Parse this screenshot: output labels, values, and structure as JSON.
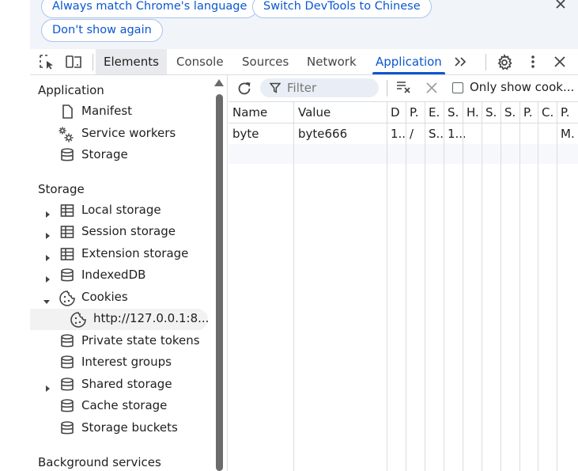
{
  "language_bar": {
    "always_match_label": "Always match Chrome's language",
    "switch_label": "Switch DevTools to Chinese",
    "dont_show_label": "Don't show again"
  },
  "toolbar": {
    "tabs": [
      {
        "label": "Elements"
      },
      {
        "label": "Console"
      },
      {
        "label": "Sources"
      },
      {
        "label": "Network"
      },
      {
        "label": "Application"
      }
    ],
    "more_tabs_label": "»",
    "accent": "#0b57d0"
  },
  "sidebar": {
    "application_heading": "Application",
    "application_items": [
      {
        "label": "Manifest",
        "icon": "file-icon"
      },
      {
        "label": "Service workers",
        "icon": "gears-icon"
      },
      {
        "label": "Storage",
        "icon": "database-icon"
      }
    ],
    "storage_heading": "Storage",
    "storage_items": [
      {
        "label": "Local storage",
        "icon": "table-icon",
        "expander": "collapsed"
      },
      {
        "label": "Session storage",
        "icon": "table-icon",
        "expander": "collapsed"
      },
      {
        "label": "Extension storage",
        "icon": "table-icon",
        "expander": "collapsed"
      },
      {
        "label": "IndexedDB",
        "icon": "database-icon",
        "expander": "collapsed"
      },
      {
        "label": "Cookies",
        "icon": "cookie-icon",
        "expander": "expanded"
      },
      {
        "label": "http://127.0.0.1:8...",
        "icon": "cookie-icon",
        "expander": "none",
        "selected": true
      },
      {
        "label": "Private state tokens",
        "icon": "database-icon",
        "expander": "none"
      },
      {
        "label": "Interest groups",
        "icon": "database-icon",
        "expander": "none"
      },
      {
        "label": "Shared storage",
        "icon": "database-icon",
        "expander": "collapsed"
      },
      {
        "label": "Cache storage",
        "icon": "database-icon",
        "expander": "none"
      },
      {
        "label": "Storage buckets",
        "icon": "database-icon",
        "expander": "none"
      }
    ],
    "background_heading": "Background services"
  },
  "main": {
    "filter_placeholder": "Filter",
    "only_show_label": "Only show cook...",
    "columns": [
      "Name",
      "Value",
      "D",
      "P.",
      "E.",
      "S.",
      "H.",
      "S.",
      "S.",
      "P.",
      "C.",
      "P."
    ],
    "rows": [
      [
        "byte",
        "byte666",
        "1..",
        "/",
        "S..",
        "1...",
        "",
        "",
        "",
        "",
        "",
        "M."
      ]
    ]
  }
}
